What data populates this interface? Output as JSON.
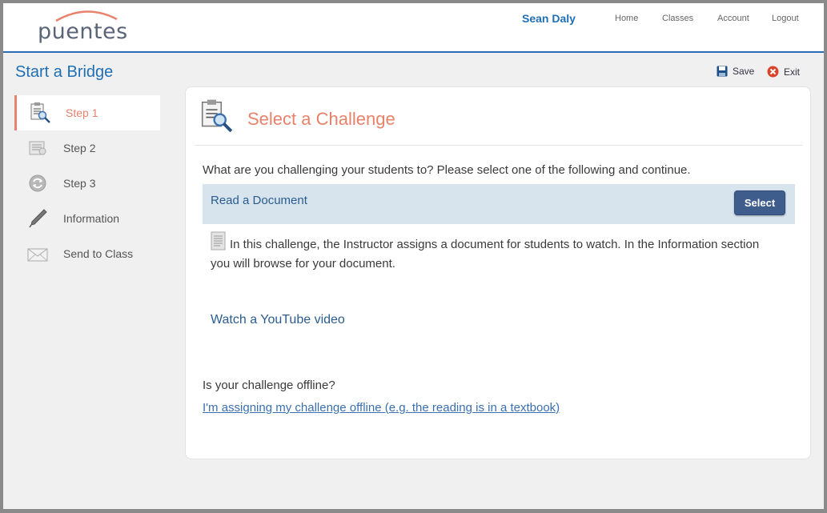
{
  "header": {
    "logo_text": "puentes",
    "user_name": "Sean Daly",
    "nav": [
      "Home",
      "Classes",
      "Account",
      "Logout"
    ]
  },
  "page": {
    "title": "Start a Bridge",
    "save_label": "Save",
    "exit_label": "Exit"
  },
  "sidebar": {
    "items": [
      {
        "label": "Step 1",
        "icon": "document-search-icon",
        "active": true
      },
      {
        "label": "Step 2",
        "icon": "document-icon",
        "active": false
      },
      {
        "label": "Step 3",
        "icon": "refresh-icon",
        "active": false
      },
      {
        "label": "Information",
        "icon": "pen-icon",
        "active": false
      },
      {
        "label": "Send to Class",
        "icon": "envelope-icon",
        "active": false
      }
    ]
  },
  "main": {
    "title": "Select a Challenge",
    "prompt": "What are you challenging your students to? Please select one of the following and continue.",
    "options": [
      {
        "title": "Read a Document",
        "button_label": "Select",
        "description": "In this challenge, the Instructor assigns a document for students to watch. In the Information section you will browse for your document."
      },
      {
        "title": "Watch a YouTube video"
      }
    ],
    "offline_question": "Is your challenge offline?",
    "offline_link": "I'm assigning my challenge offline (e.g. the reading is in a textbook)"
  },
  "colors": {
    "accent": "#e8826a",
    "brand_blue": "#1f6fb5",
    "option_bg": "#d7e4ee",
    "button_bg": "#3f5d8c"
  }
}
